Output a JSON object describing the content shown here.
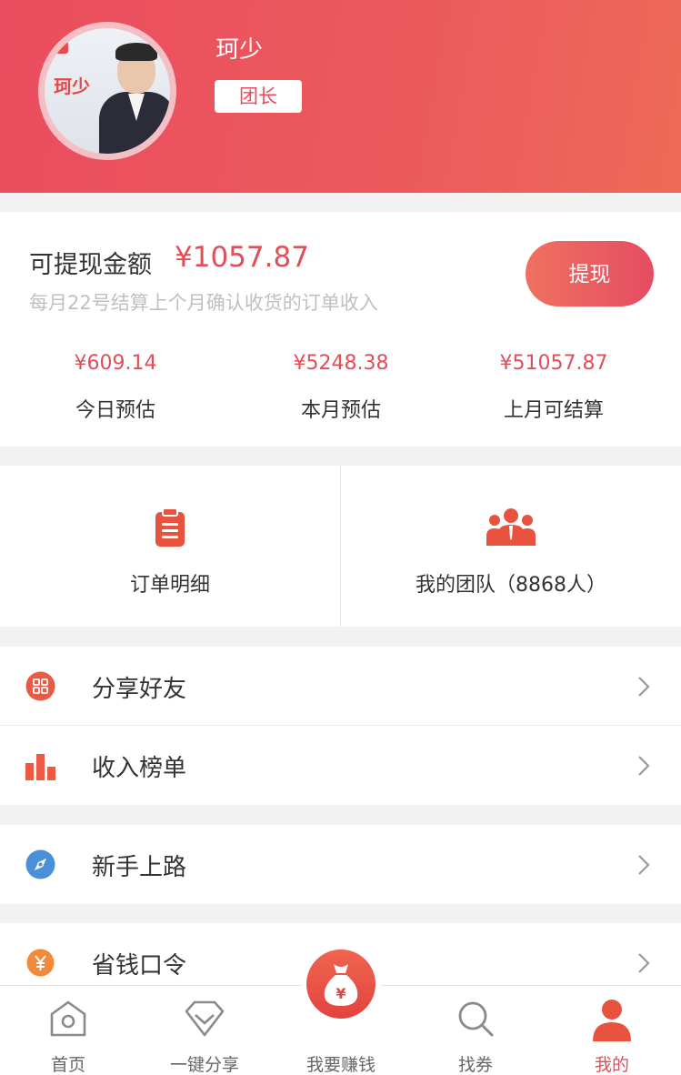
{
  "profile": {
    "name": "珂少",
    "role": "团长",
    "avatar_text": "珂少"
  },
  "balance": {
    "label": "可提现金额",
    "value": "¥1057.87",
    "note": "每月22号结算上个月确认收货的订单收入",
    "withdraw_label": "提现"
  },
  "stats": [
    {
      "value": "¥609.14",
      "label": "今日预估"
    },
    {
      "value": "¥5248.38",
      "label": "本月预估"
    },
    {
      "value": "¥51057.87",
      "label": "上月可结算"
    }
  ],
  "quick": {
    "orders_label": "订单明细",
    "team_label": "我的团队（8868人）"
  },
  "menu": {
    "group1": [
      {
        "label": "分享好友",
        "icon": "share-icon"
      },
      {
        "label": "收入榜单",
        "icon": "chart-icon"
      }
    ],
    "group2": [
      {
        "label": "新手上路",
        "icon": "compass-icon"
      }
    ],
    "group3": [
      {
        "label": "省钱口令",
        "icon": "yen-icon"
      }
    ]
  },
  "tabs": [
    {
      "label": "首页",
      "icon": "home-icon"
    },
    {
      "label": "一键分享",
      "icon": "diamond-icon"
    },
    {
      "label": "我要赚钱",
      "icon": "money-bag-icon"
    },
    {
      "label": "找券",
      "icon": "search-icon"
    },
    {
      "label": "我的",
      "icon": "user-icon",
      "active": true
    }
  ],
  "colors": {
    "accent": "#e24e58",
    "header_start": "#ea4d5f",
    "header_end": "#ee6a58"
  }
}
